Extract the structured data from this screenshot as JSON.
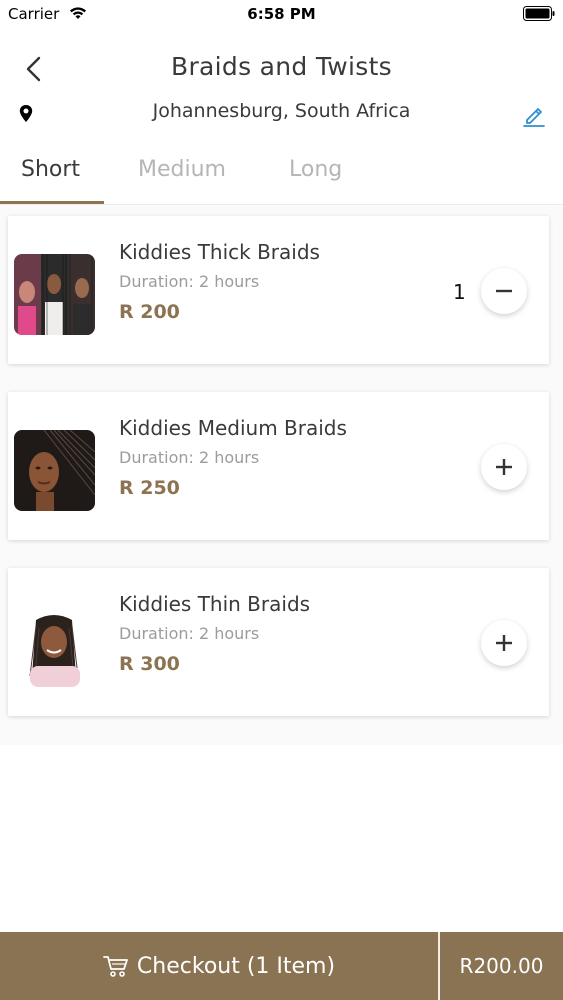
{
  "status_bar": {
    "carrier": "Carrier",
    "time": "6:58 PM"
  },
  "header": {
    "title": "Braids and Twists",
    "location": "Johannesburg, South Africa"
  },
  "tabs": [
    {
      "label": "Short",
      "active": true
    },
    {
      "label": "Medium",
      "active": false
    },
    {
      "label": "Long",
      "active": false
    }
  ],
  "items": [
    {
      "name": "Kiddies Thick Braids",
      "duration": "Duration: 2 hours",
      "price": "R 200",
      "quantity": "1",
      "action_icon": "minus-icon"
    },
    {
      "name": "Kiddies Medium Braids",
      "duration": "Duration: 2 hours",
      "price": "R 250",
      "quantity": "",
      "action_icon": "plus-icon"
    },
    {
      "name": "Kiddies Thin Braids",
      "duration": "Duration: 2 hours",
      "price": "R 300",
      "quantity": "",
      "action_icon": "plus-icon"
    }
  ],
  "checkout": {
    "label": "Checkout (1 Item)",
    "total": "R200.00"
  },
  "colors": {
    "accent": "#8c7351",
    "checkout_bg": "#8a7352",
    "edit_icon": "#2f8fd0"
  }
}
